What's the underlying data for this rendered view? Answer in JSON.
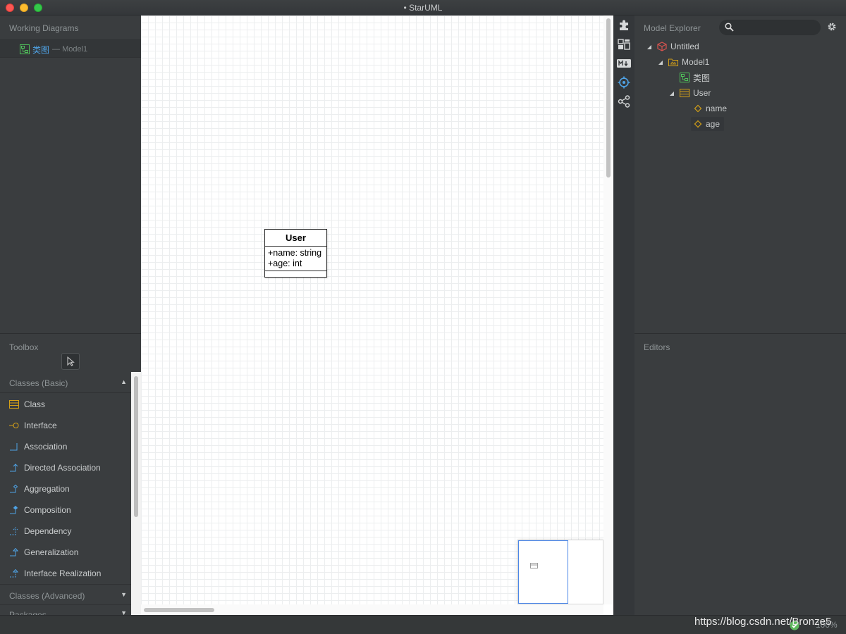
{
  "window": {
    "title": "• StarUML"
  },
  "working_diagrams": {
    "header": "Working Diagrams",
    "items": [
      {
        "name": "类图",
        "model": "— Model1",
        "icon": "class-diagram-icon"
      }
    ]
  },
  "toolbox": {
    "header": "Toolbox",
    "pointer_icon": "pointer-icon",
    "categories": [
      {
        "label": "Classes (Basic)",
        "expanded": true
      },
      {
        "label": "Classes (Advanced)",
        "expanded": false
      },
      {
        "label": "Packages",
        "expanded": false
      }
    ],
    "items": [
      {
        "label": "Class",
        "icon": "class-icon"
      },
      {
        "label": "Interface",
        "icon": "interface-icon"
      },
      {
        "label": "Association",
        "icon": "association-icon"
      },
      {
        "label": "Directed Association",
        "icon": "directed-association-icon"
      },
      {
        "label": "Aggregation",
        "icon": "aggregation-icon"
      },
      {
        "label": "Composition",
        "icon": "composition-icon"
      },
      {
        "label": "Dependency",
        "icon": "dependency-icon"
      },
      {
        "label": "Generalization",
        "icon": "generalization-icon"
      },
      {
        "label": "Interface Realization",
        "icon": "interface-realization-icon"
      }
    ]
  },
  "canvas": {
    "class_box": {
      "name": "User",
      "attributes": [
        "+name: string",
        "+age: int"
      ],
      "operations": []
    }
  },
  "side_toolbar": {
    "buttons": [
      "extension-icon",
      "layout-icon",
      "markdown-icon",
      "navigate-icon",
      "share-icon"
    ]
  },
  "model_explorer": {
    "header": "Model Explorer",
    "search_placeholder": "",
    "tree": [
      {
        "label": "Untitled",
        "icon": "project-icon"
      },
      {
        "label": "Model1",
        "icon": "model-icon"
      },
      {
        "label": "类图",
        "icon": "class-diagram-icon"
      },
      {
        "label": "User",
        "icon": "class-icon"
      },
      {
        "label": "name",
        "icon": "attribute-icon"
      },
      {
        "label": "age",
        "icon": "attribute-icon"
      }
    ]
  },
  "editors": {
    "header": "Editors"
  },
  "status": {
    "zoom": "100%",
    "watermark": "https://blog.csdn.net/Bronze5"
  },
  "colors": {
    "accent": "#4a86e8",
    "link": "#4fa3e6",
    "panel": "#3a3d3f",
    "tree_icon": "#d4a017"
  }
}
